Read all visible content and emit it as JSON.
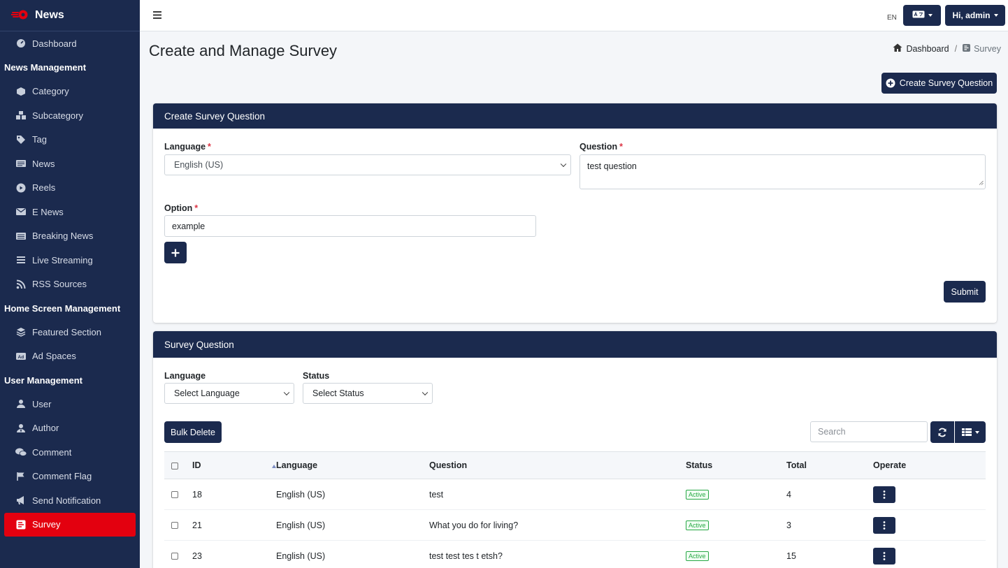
{
  "brand": {
    "name": "News"
  },
  "sidebar": {
    "dashboard": "Dashboard",
    "sections": [
      {
        "header": "News Management",
        "items": [
          "Category",
          "Subcategory",
          "Tag",
          "News",
          "Reels",
          "E News",
          "Breaking News",
          "Live Streaming",
          "RSS Sources"
        ]
      },
      {
        "header": "Home Screen Management",
        "items": [
          "Featured Section",
          "Ad Spaces"
        ]
      },
      {
        "header": "User Management",
        "items": [
          "User",
          "Author",
          "Comment",
          "Comment Flag",
          "Send Notification",
          "Survey"
        ]
      }
    ],
    "active_item": "Survey"
  },
  "topbar": {
    "lang_code": "EN",
    "user_label": "Hi, admin"
  },
  "page": {
    "title": "Create and Manage Survey",
    "breadcrumb": {
      "home": "Dashboard",
      "current": "Survey"
    },
    "create_button": "Create Survey Question"
  },
  "form": {
    "header": "Create Survey Question",
    "language_label": "Language",
    "language_value": "English (US)",
    "question_label": "Question",
    "question_value": "test question",
    "option_label": "Option",
    "option_value": "example",
    "submit_label": "Submit"
  },
  "list": {
    "header": "Survey Question",
    "language_label": "Language",
    "language_placeholder": "Select Language",
    "status_label": "Status",
    "status_placeholder": "Select Status",
    "bulk_delete": "Bulk Delete",
    "search_placeholder": "Search",
    "columns": {
      "id": "ID",
      "language": "Language",
      "question": "Question",
      "status": "Status",
      "total": "Total",
      "operate": "Operate"
    },
    "rows": [
      {
        "id": "18",
        "language": "English (US)",
        "question": "test",
        "status": "Active",
        "total": "4"
      },
      {
        "id": "21",
        "language": "English (US)",
        "question": "What you do for living?",
        "status": "Active",
        "total": "3"
      },
      {
        "id": "23",
        "language": "English (US)",
        "question": "test test tes t etsh?",
        "status": "Active",
        "total": "15"
      }
    ]
  },
  "colors": {
    "navy": "#1b2a4e",
    "active_red": "#e3000f",
    "success": "#28a745"
  }
}
